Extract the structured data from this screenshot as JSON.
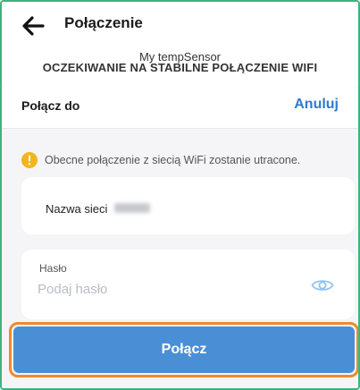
{
  "header": {
    "title": "Połączenie",
    "back_icon": "arrow-left-icon"
  },
  "device": {
    "name": "My tempSensor",
    "status": "OCZEKIWANIE NA STABILNE POŁĄCZENIE WIFI"
  },
  "sheet": {
    "title": "Połącz do",
    "cancel_label": "Anuluj",
    "warning": {
      "icon": "warning-icon",
      "text": "Obecne połączenie z siecią WiFi zostanie utracone."
    },
    "network": {
      "label": "Nazwa sieci"
    },
    "password": {
      "label": "Hasło",
      "placeholder": "Podaj hasło",
      "value": "",
      "visibility_icon": "eye-icon"
    },
    "connect_label": "Połącz"
  },
  "colors": {
    "accent_blue": "#4a8fd6",
    "link_blue": "#2f7ad1",
    "highlight_orange": "#f08a2a",
    "frame_green": "#3fb37f",
    "warning_yellow": "#f2b51c"
  }
}
